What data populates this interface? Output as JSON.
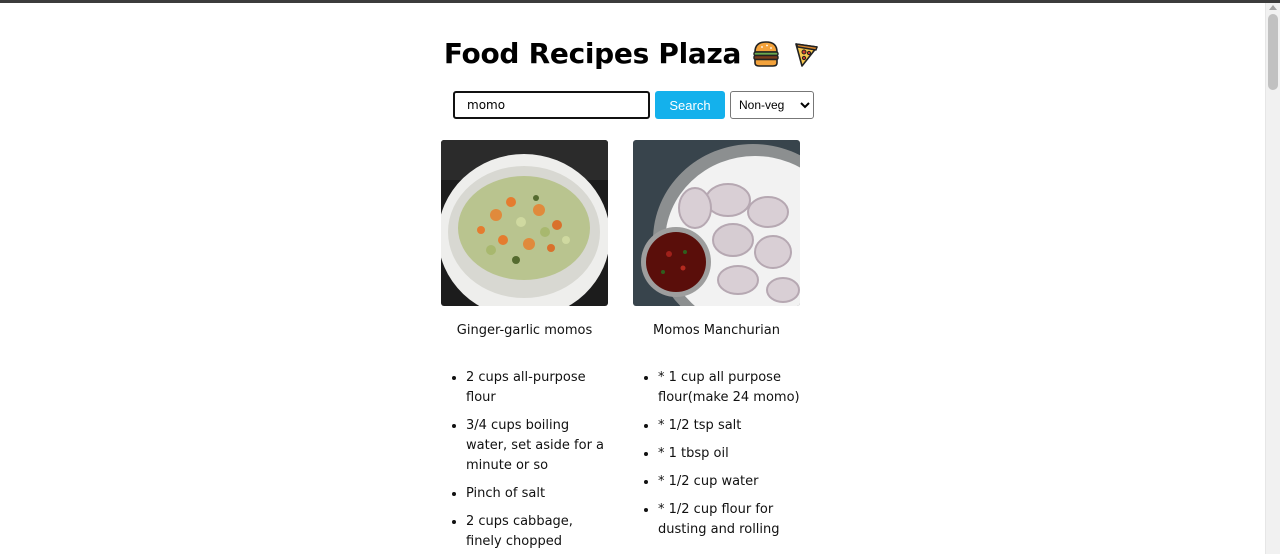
{
  "page": {
    "title": "Food Recipes Plaza"
  },
  "header_icons": [
    "burger-emoji",
    "pizza-emoji"
  ],
  "search": {
    "value": "momo",
    "button_label": "Search",
    "filter_selected": "Non-veg"
  },
  "recipes": [
    {
      "title": "Ginger-garlic momos",
      "ingredients": [
        "2 cups all-purpose flour",
        "3/4 cups boiling water, set aside for a minute or so",
        "Pinch of salt",
        "2 cups cabbage, finely chopped"
      ]
    },
    {
      "title": "Momos Manchurian",
      "ingredients": [
        "* 1 cup all purpose flour(make 24 momo)",
        "* 1/2 tsp salt",
        "* 1 tbsp oil",
        "* 1/2 cup water",
        "* 1/2 cup flour for dusting and rolling"
      ]
    }
  ],
  "colors": {
    "accent": "#14b1ec",
    "text": "#111111",
    "background": "#ffffff"
  }
}
